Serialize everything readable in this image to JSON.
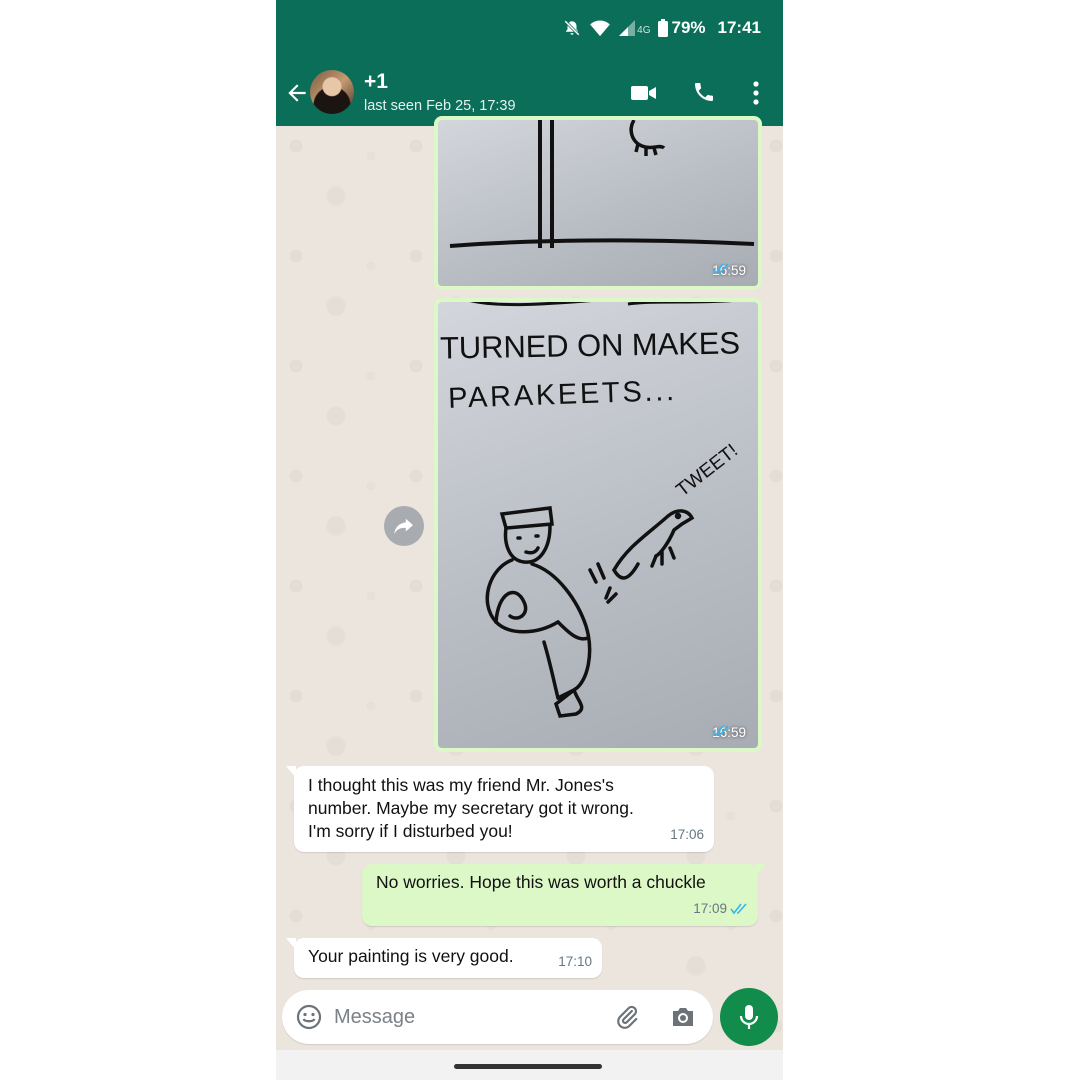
{
  "status_bar": {
    "network": "4G",
    "battery": "79%",
    "time": "17:41"
  },
  "header": {
    "contact_name": "+1",
    "last_seen": "last seen Feb 25, 17:39",
    "icons": [
      "back-arrow-icon",
      "video-call-icon",
      "phone-icon",
      "more-vert-icon"
    ]
  },
  "messages": [
    {
      "type": "image",
      "direction": "outgoing",
      "time": "16:59",
      "status": "read"
    },
    {
      "type": "image",
      "direction": "outgoing",
      "time": "16:59",
      "status": "read",
      "image_text": [
        "TURNED ON MAKES",
        "PARAKEETS...",
        "TWEET!"
      ]
    },
    {
      "type": "text",
      "direction": "incoming",
      "time": "17:06",
      "lines": [
        "I thought this was my friend Mr. Jones's",
        "number. Maybe my secretary got it wrong.",
        "I'm sorry if I disturbed you!"
      ]
    },
    {
      "type": "text",
      "direction": "outgoing",
      "time": "17:09",
      "status": "read",
      "lines": [
        "No worries. Hope this was worth a chuckle"
      ]
    },
    {
      "type": "text",
      "direction": "incoming",
      "time": "17:10",
      "lines": [
        "Your painting is very good."
      ]
    }
  ],
  "composer": {
    "placeholder": "Message",
    "icons": [
      "emoji-icon",
      "attach-icon",
      "camera-icon",
      "mic-icon"
    ]
  },
  "colors": {
    "header": "#0b6e58",
    "outgoing_bubble": "#dcf8c6",
    "incoming_bubble": "#ffffff",
    "mic_button": "#128c4b",
    "read_ticks": "#34b7f1"
  }
}
